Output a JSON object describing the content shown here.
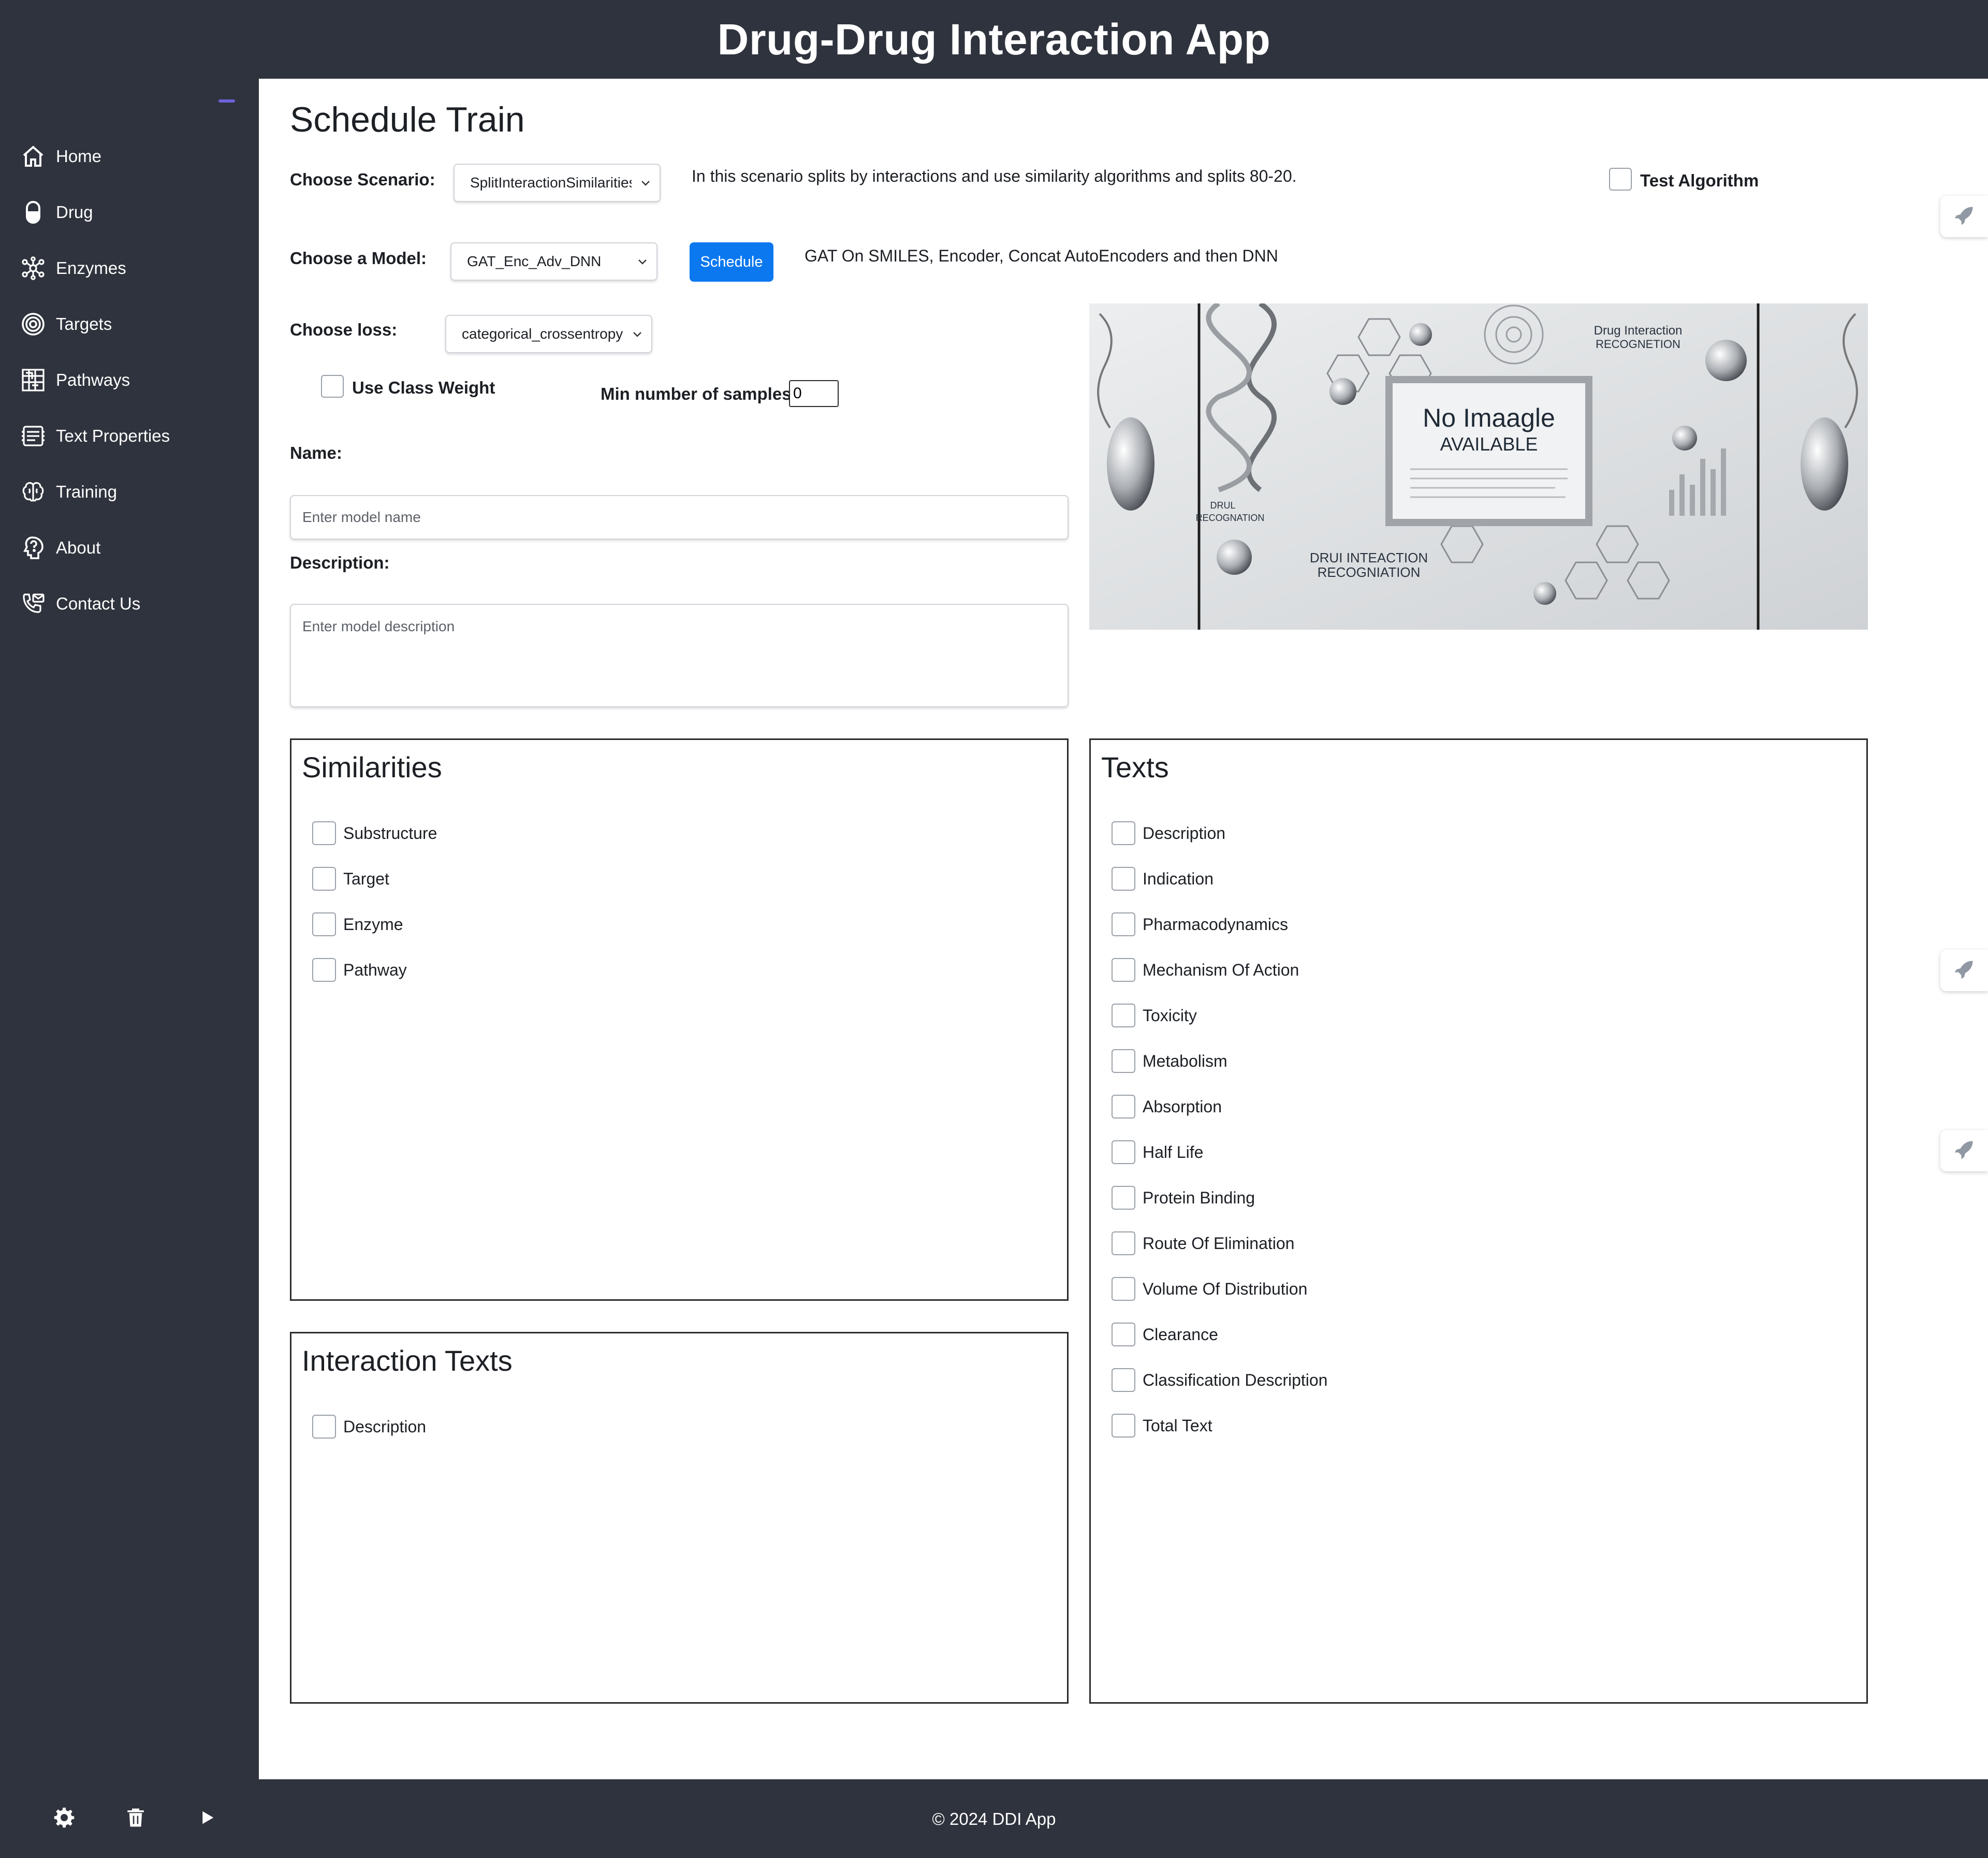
{
  "app": {
    "title": "Drug-Drug Interaction App"
  },
  "sidebar": {
    "items": [
      {
        "label": "Home",
        "icon": "home-icon"
      },
      {
        "label": "Drug",
        "icon": "pill-icon"
      },
      {
        "label": "Enzymes",
        "icon": "enzyme-icon"
      },
      {
        "label": "Targets",
        "icon": "target-icon"
      },
      {
        "label": "Pathways",
        "icon": "pathway-icon"
      },
      {
        "label": "Text Properties",
        "icon": "text-properties-icon"
      },
      {
        "label": "Training",
        "icon": "brain-icon"
      },
      {
        "label": "About",
        "icon": "about-icon"
      },
      {
        "label": "Contact Us",
        "icon": "contact-icon"
      }
    ]
  },
  "page": {
    "title": "Schedule Train"
  },
  "form": {
    "scenario_label": "Choose Scenario:",
    "scenario_value": "SplitInteractionSimilarities",
    "scenario_description": "In this scenario splits by interactions and use similarity algorithms and splits 80-20.",
    "test_algorithm_label": "Test Algorithm",
    "model_label": "Choose a Model:",
    "model_value": "GAT_Enc_Adv_DNN",
    "schedule_label": "Schedule",
    "model_description": "GAT On SMILES, Encoder, Concat AutoEncoders and then DNN",
    "loss_label": "Choose loss:",
    "loss_value": "categorical_crossentropy",
    "class_weight_label": "Use Class Weight",
    "min_samples_label": "Min number of samples",
    "min_samples_value": "0",
    "name_label": "Name:",
    "name_placeholder": "Enter model name",
    "description_label": "Description:",
    "description_placeholder": "Enter model description"
  },
  "hero": {
    "headline": "No Imaagle",
    "subheadline": "AVAILABLE",
    "caption_top": "Drug Interaction",
    "caption_top2": "RECOGNETION",
    "caption_bottom": "DRUI INTEACTION",
    "caption_bottom2": "RECOGNIATION",
    "caption_left": "DRUL",
    "caption_left2": "RECOGNATION"
  },
  "similarities": {
    "title": "Similarities",
    "items": [
      "Substructure",
      "Target",
      "Enzyme",
      "Pathway"
    ]
  },
  "interaction_texts": {
    "title": "Interaction Texts",
    "items": [
      "Description"
    ]
  },
  "texts": {
    "title": "Texts",
    "items": [
      "Description",
      "Indication",
      "Pharmacodynamics",
      "Mechanism Of Action",
      "Toxicity",
      "Metabolism",
      "Absorption",
      "Half Life",
      "Protein Binding",
      "Route Of Elimination",
      "Volume Of Distribution",
      "Clearance",
      "Classification Description",
      "Total Text"
    ]
  },
  "footer": {
    "copyright": "© 2024 DDI App"
  },
  "colors": {
    "chrome": "#2f333d",
    "accent": "#0b78f0",
    "toggle": "#6c63d9"
  }
}
